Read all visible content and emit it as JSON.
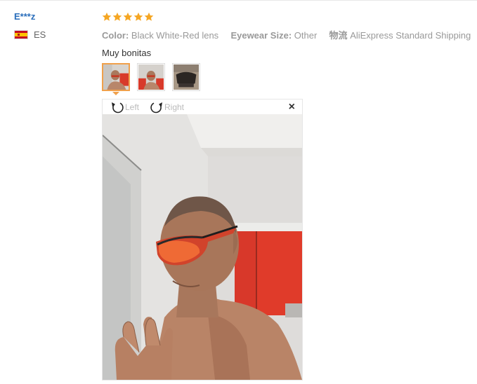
{
  "reviewer": {
    "name": "E***z",
    "country_code": "ES",
    "flag_icon": "spain-flag-icon"
  },
  "review": {
    "rating": 5,
    "star_color": "#f5a623",
    "attributes": [
      {
        "key": "Color:",
        "value": "Black White-Red lens"
      },
      {
        "key": "Eyewear Size:",
        "value": "Other"
      },
      {
        "key": "物流",
        "value": "AliExpress Standard Shipping"
      }
    ],
    "comment": "Muy bonitas"
  },
  "thumbnails": {
    "count": 3,
    "selected_index": 0,
    "selected_border_color": "#f0a04b"
  },
  "viewer": {
    "rotate_left_label": "Left",
    "rotate_right_label": "Right",
    "close_label": "×"
  }
}
